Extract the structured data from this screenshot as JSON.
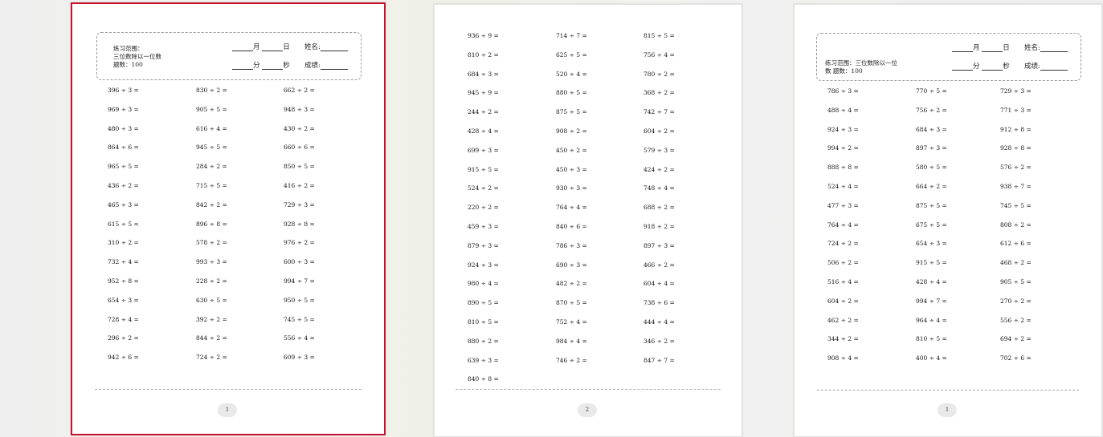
{
  "sheets": [
    {
      "header": {
        "range_label": "练习范围：",
        "range_value": "三位数除以一位数",
        "count_label": "题数：100",
        "month_label": "月",
        "day_label": "日",
        "name_label": "姓名:",
        "minute_label": "分",
        "second_label": "秒",
        "score_label": "成绩:"
      },
      "columns": [
        [
          "396 ÷ 3 =",
          "969 ÷ 3 =",
          "480 ÷ 3 =",
          "864 ÷ 6 =",
          "965 ÷ 5 =",
          "436 ÷ 2 =",
          "465 ÷ 3 =",
          "615 ÷ 5 =",
          "310 ÷ 2 =",
          "732 ÷ 4 =",
          "952 ÷ 8 =",
          "654 ÷ 3 =",
          "728 ÷ 4 =",
          "296 ÷ 2 =",
          "942 ÷ 6 ="
        ],
        [
          "830 ÷ 2 =",
          "905 ÷ 5 =",
          "616 ÷ 4 =",
          "945 ÷ 5 =",
          "284 ÷ 2 =",
          "715 ÷ 5 =",
          "842 ÷ 2 =",
          "896 ÷ 8 =",
          "578 ÷ 2 =",
          "993 ÷ 3 =",
          "228 ÷ 2 =",
          "630 ÷ 5 =",
          "392 ÷ 2 =",
          "844 ÷ 2 =",
          "724 ÷ 2 ="
        ],
        [
          "662 ÷ 2 =",
          "948 ÷ 3 =",
          "430 ÷ 2 =",
          "660 ÷ 6 =",
          "850 ÷ 5 =",
          "416 ÷ 2 =",
          "729 ÷ 3 =",
          "928 ÷ 8 =",
          "976 ÷ 2 =",
          "600 ÷ 3 =",
          "994 ÷ 7 =",
          "950 ÷ 5 =",
          "745 ÷ 5 =",
          "556 ÷ 4 =",
          "609 ÷ 3 ="
        ]
      ],
      "page_number": "1"
    },
    {
      "columns": [
        [
          "936 ÷ 9 =",
          "810 ÷ 2 =",
          "684 ÷ 3 =",
          "945 ÷ 9 =",
          "244 ÷ 2 =",
          "428 ÷ 4 =",
          "699 ÷ 3 =",
          "915 ÷ 5 =",
          "524 ÷ 2 =",
          "220 ÷ 2 =",
          "459 ÷ 3 =",
          "879 ÷ 3 =",
          "924 ÷ 3 =",
          "980 ÷ 4 =",
          "890 ÷ 5 =",
          "810 ÷ 5 =",
          "880 ÷ 2 =",
          "639 ÷ 3 =",
          "840 ÷ 8 ="
        ],
        [
          "714 ÷ 7 =",
          "625 ÷ 5 =",
          "520 ÷ 4 =",
          "880 ÷ 5 =",
          "875 ÷ 5 =",
          "908 ÷ 2 =",
          "450 ÷ 2 =",
          "450 ÷ 3 =",
          "930 ÷ 3 =",
          "764 ÷ 4 =",
          "840 ÷ 6 =",
          "786 ÷ 3 =",
          "690 ÷ 3 =",
          "482 ÷ 2 =",
          "870 ÷ 5 =",
          "752 ÷ 4 =",
          "984 ÷ 4 =",
          "746 ÷ 2 ="
        ],
        [
          "815 ÷ 5 =",
          "756 ÷ 4 =",
          "780 ÷ 2 =",
          "368 ÷ 2 =",
          "742 ÷ 7 =",
          "604 ÷ 2 =",
          "579 ÷ 3 =",
          "424 ÷ 2 =",
          "748 ÷ 4 =",
          "688 ÷ 2 =",
          "918 ÷ 2 =",
          "897 ÷ 3 =",
          "466 ÷ 2 =",
          "604 ÷ 4 =",
          "738 ÷ 6 =",
          "444 ÷ 4 =",
          "346 ÷ 2 =",
          "847 ÷ 7 ="
        ]
      ],
      "page_number": "2"
    },
    {
      "header": {
        "range_text": "练习范围：三位数除以一位",
        "range_text2": "数 题数：100",
        "month_label": "月",
        "day_label": "日",
        "name_label": "姓名:",
        "minute_label": "分",
        "second_label": "秒",
        "score_label": "成绩:"
      },
      "columns": [
        [
          "786 ÷ 3 =",
          "488 ÷ 4 =",
          "924 ÷ 3 =",
          "994 ÷ 2 =",
          "888 ÷ 8 =",
          "524 ÷ 4 =",
          "477 ÷ 3 =",
          "764 ÷ 4 =",
          "724 ÷ 2 =",
          "506 ÷ 2 =",
          "516 ÷ 4 =",
          "604 ÷ 2 =",
          "462 ÷ 2 =",
          "344 ÷ 2 =",
          "908 ÷ 4 ="
        ],
        [
          "770 ÷ 5 =",
          "756 ÷ 2 =",
          "684 ÷ 3 =",
          "897 ÷ 3 =",
          "580 ÷ 5 =",
          "664 ÷ 2 =",
          "875 ÷ 5 =",
          "675 ÷ 5 =",
          "654 ÷ 3 =",
          "915 ÷ 5 =",
          "428 ÷ 4 =",
          "994 ÷ 7 =",
          "964 ÷ 4 =",
          "810 ÷ 5 =",
          "400 ÷ 4 ="
        ],
        [
          "729 ÷ 3 =",
          "771 ÷ 3 =",
          "912 ÷ 8 =",
          "928 ÷ 8 =",
          "576 ÷ 2 =",
          "938 ÷ 7 =",
          "745 ÷ 5 =",
          "808 ÷ 2 =",
          "612 ÷ 6 =",
          "468 ÷ 2 =",
          "905 ÷ 5 =",
          "270 ÷ 2 =",
          "556 ÷ 2 =",
          "694 ÷ 2 =",
          "702 ÷ 6 ="
        ]
      ],
      "page_number": "1"
    }
  ]
}
